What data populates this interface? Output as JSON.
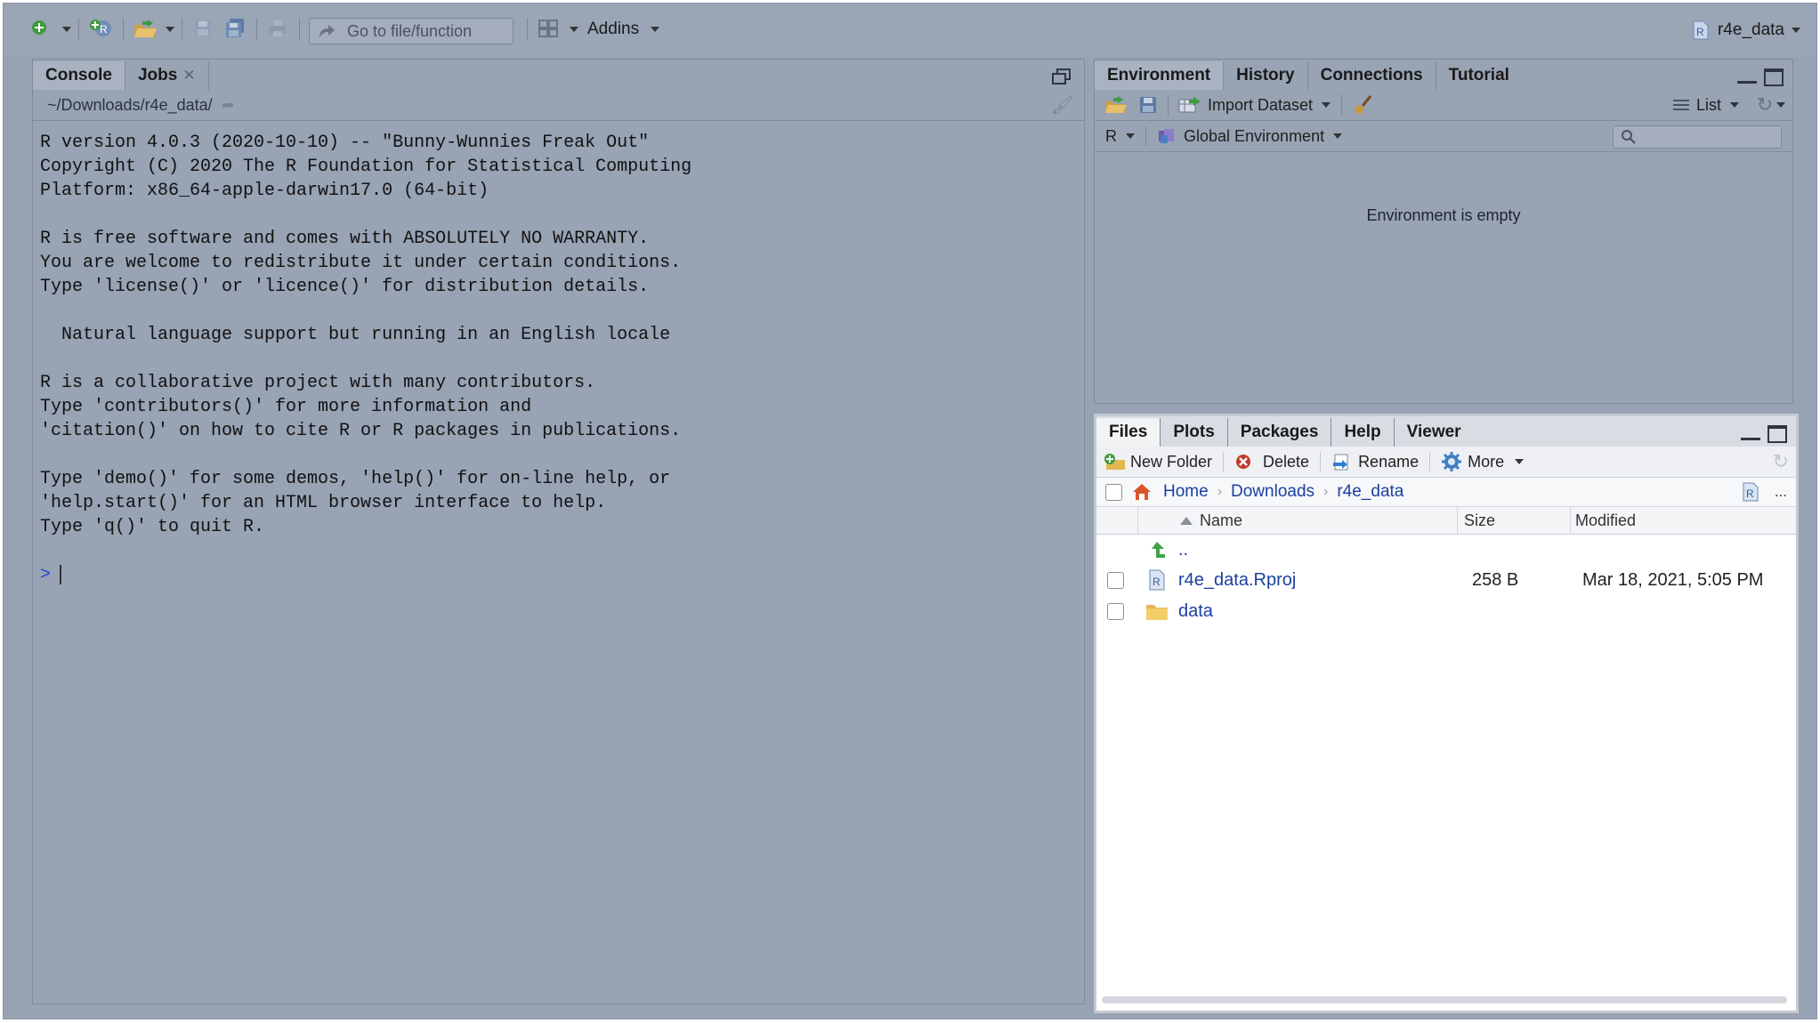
{
  "toolbar": {
    "goto_placeholder": "Go to file/function",
    "addins_label": "Addins",
    "project_name": "r4e_data",
    "icons": [
      "new-file-icon",
      "new-project-icon",
      "open-file-icon",
      "save-icon",
      "save-all-icon",
      "print-icon",
      "go-to-arrow-icon",
      "layout-grid-icon",
      "r-project-icon"
    ]
  },
  "console_pane": {
    "tabs": [
      {
        "label": "Console",
        "active": true
      },
      {
        "label": "Jobs",
        "active": false,
        "closable": true
      }
    ],
    "working_dir": "~/Downloads/r4e_data/",
    "output_lines": [
      "R version 4.0.3 (2020-10-10) -- \"Bunny-Wunnies Freak Out\"",
      "Copyright (C) 2020 The R Foundation for Statistical Computing",
      "Platform: x86_64-apple-darwin17.0 (64-bit)",
      "",
      "R is free software and comes with ABSOLUTELY NO WARRANTY.",
      "You are welcome to redistribute it under certain conditions.",
      "Type 'license()' or 'licence()' for distribution details.",
      "",
      "  Natural language support but running in an English locale",
      "",
      "R is a collaborative project with many contributors.",
      "Type 'contributors()' for more information and",
      "'citation()' on how to cite R or R packages in publications.",
      "",
      "Type 'demo()' for some demos, 'help()' for on-line help, or",
      "'help.start()' for an HTML browser interface to help.",
      "Type 'q()' to quit R.",
      ""
    ],
    "prompt": ">"
  },
  "environment_pane": {
    "tabs": [
      {
        "label": "Environment",
        "active": true
      },
      {
        "label": "History",
        "active": false
      },
      {
        "label": "Connections",
        "active": false
      },
      {
        "label": "Tutorial",
        "active": false
      }
    ],
    "import_label": "Import Dataset",
    "view_label": "List",
    "language": "R",
    "scope": "Global Environment",
    "search_placeholder": "",
    "empty_message": "Environment is empty"
  },
  "files_pane": {
    "tabs": [
      {
        "label": "Files",
        "active": true
      },
      {
        "label": "Plots",
        "active": false
      },
      {
        "label": "Packages",
        "active": false
      },
      {
        "label": "Help",
        "active": false
      },
      {
        "label": "Viewer",
        "active": false
      }
    ],
    "actions": {
      "new_folder": "New Folder",
      "delete": "Delete",
      "rename": "Rename",
      "more": "More"
    },
    "breadcrumb": [
      "Home",
      "Downloads",
      "r4e_data"
    ],
    "more_ellipsis": "...",
    "columns": {
      "name": "Name",
      "size": "Size",
      "modified": "Modified"
    },
    "up_label": "..",
    "rows": [
      {
        "name": "r4e_data.Rproj",
        "size": "258 B",
        "modified": "Mar 18, 2021, 5:05 PM",
        "type": "rproj"
      },
      {
        "name": "data",
        "size": "",
        "modified": "",
        "type": "folder"
      }
    ]
  },
  "colors": {
    "background": "#97a2b3",
    "link": "#1a3fa0",
    "files_bg": "#ffffff",
    "prompt": "#2149c9"
  }
}
